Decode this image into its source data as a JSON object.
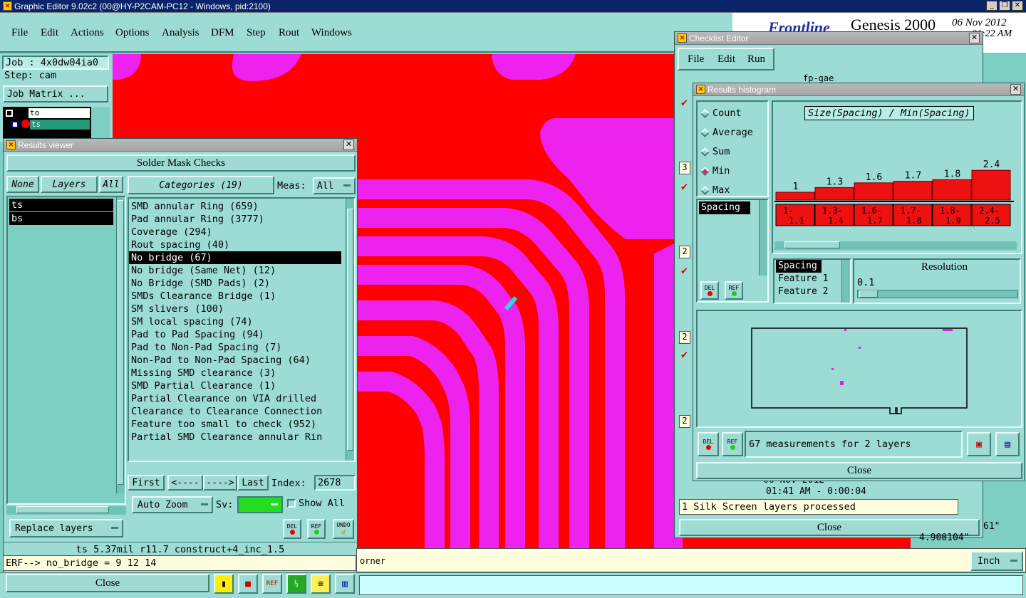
{
  "app": {
    "title": "Graphic Editor 9.02c2 (00@HY-P2CAM-PC12 - Windows, pid:2100)",
    "menu": [
      "File",
      "Edit",
      "Actions",
      "Options",
      "Analysis",
      "DFM",
      "Step",
      "Rout",
      "Windows"
    ],
    "brand": "Genesis 2000",
    "date": "06 Nov 2012",
    "time": "01:22 AM",
    "job": "Job : 4x0dw04ia0",
    "step": "Step: cam",
    "job_matrix": "Job Matrix ...",
    "layers_small": [
      "to",
      "ts"
    ],
    "bottom_status_text": "orner",
    "units": "Inch",
    "coord1": "61\"",
    "coord2": "4.900104\""
  },
  "results_viewer": {
    "title": "Results viewer",
    "header": "Solder Mask Checks",
    "buttons": {
      "none": "None",
      "layers": "Layers",
      "all": "All",
      "categories": "Categories (19)",
      "meas_label": "Meas:",
      "meas_value": "All"
    },
    "layers": [
      "ts",
      "bs"
    ],
    "categories": [
      "SMD annular Ring (659)",
      "Pad annular Ring (3777)",
      "Coverage (294)",
      "Rout spacing (40)",
      "No bridge (67)",
      "No bridge (Same Net) (12)",
      "No Bridge (SMD Pads) (2)",
      "SMDs Clearance Bridge (1)",
      "SM slivers (100)",
      "SM local spacing (74)",
      "Pad to Pad Spacing (94)",
      "Pad to Non-Pad Spacing (7)",
      "Non-Pad to Non-Pad Spacing (64)",
      "Missing SMD clearance (3)",
      "SMD Partial Clearance (1)",
      "Partial Clearance on VIA drilled",
      "Clearance to Clearance Connection",
      "Feature too small to check (952)",
      "Partial SMD Clearance annular Rin"
    ],
    "selected_category": "No bridge (67)",
    "nav": {
      "first": "First",
      "prev": "<----",
      "next": "---->",
      "last": "Last",
      "index_label": "Index:",
      "index_value": "2678"
    },
    "auto_zoom": "Auto Zoom",
    "sv_label": "Sv:",
    "show_all": "Show All",
    "replace_layers": "Replace layers",
    "icons": {
      "del": "DEL",
      "ref": "REF",
      "undo": "UNDO"
    },
    "status_line": "ts 5.37mil  r11.7  construct+4_inc_1.5",
    "erf_line": "ERF--> no_bridge = 9 12 14",
    "close": "Close"
  },
  "checklist_editor": {
    "title": "Checklist Editor",
    "menu": [
      "File",
      "Edit",
      "Run"
    ],
    "label": "fp-gae",
    "left_numbers": [
      "3",
      "2",
      "2",
      "2"
    ],
    "timestamp1": "06 Nov 2012",
    "timestamp2": "01:41 AM - 0:00:04",
    "status": "1 Silk Screen layers processed",
    "close": "Close"
  },
  "histogram": {
    "title": "Results histogram",
    "modes": [
      "Count",
      "Average",
      "Sum",
      "Min",
      "Max"
    ],
    "selected_mode": "Min",
    "chart_title": "Size(Spacing) / Min(Spacing)",
    "bars": [
      1,
      1.3,
      1.6,
      1.7,
      1.8,
      2.4
    ],
    "bar_labels": [
      "1",
      "1.3",
      "1.6",
      "1.7",
      "1.8",
      "2.4"
    ],
    "bins": [
      [
        "1-",
        "1.1"
      ],
      [
        "1.3-",
        "1.4"
      ],
      [
        "1.6-",
        "1.7"
      ],
      [
        "1.7-",
        "1.8"
      ],
      [
        "1.8-",
        "1.9"
      ],
      [
        "2.4-",
        "2.5"
      ]
    ],
    "measure_list": [
      "Spacing"
    ],
    "attr_list": [
      "Spacing",
      "Feature 1",
      "Feature 2"
    ],
    "selected_attr": "Spacing",
    "resolution_label": "Resolution",
    "resolution_value": "0.1",
    "summary": "67 measurements for 2 layers",
    "close": "Close",
    "colors": {
      "bar": "#ee1111",
      "magenta": "#dd22dd"
    }
  }
}
